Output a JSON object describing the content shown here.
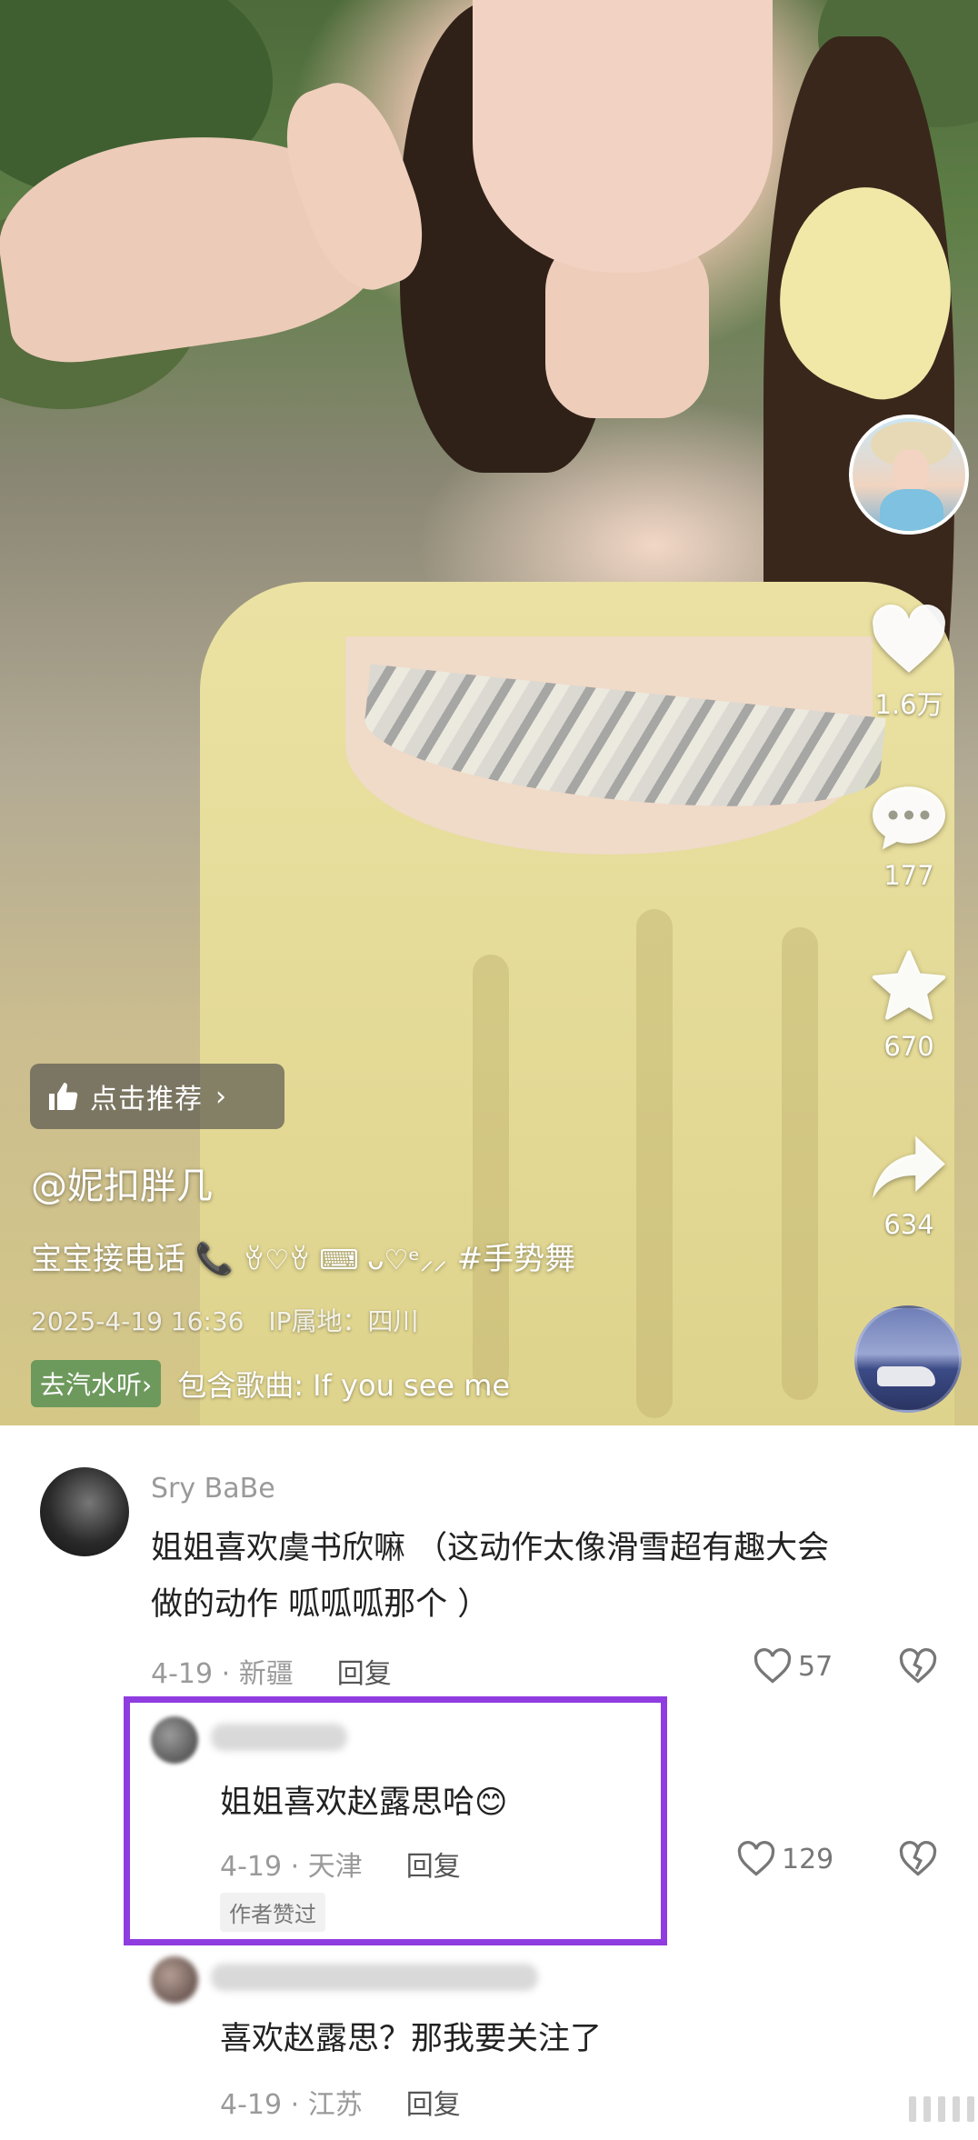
{
  "video": {
    "creator_avatar_icon": "creator-avatar",
    "likes": "1.6万",
    "comments": "177",
    "favorites": "670",
    "shares": "634",
    "recommend_label": "点击推荐",
    "author": "@妮扣胖几",
    "caption_text": "宝宝接电话",
    "caption_deco": "ꈊ♡ꈊ ⌨ ᴗ♡ᵉ⸝⸝",
    "caption_tag": "#手势舞",
    "date": "2025-4-19 16:36",
    "ip_location": "IP属地：四川",
    "music_tag": "去汽水听",
    "music_text": "包含歌曲: If you see me"
  },
  "comments": [
    {
      "name": "Sry BaBe",
      "text_line1": "姐姐喜欢虞书欣嘛 （这动作太像滑雪超有趣大会",
      "text_line2": "做的动作 呱呱呱那个 ）",
      "meta": "4-19 · 新疆",
      "reply": "回复",
      "likes": "57"
    },
    {
      "text": "姐姐喜欢赵露思哈😊",
      "meta": "4-19 · 天津",
      "reply": "回复",
      "likes": "129",
      "badge": "作者赞过"
    },
    {
      "text": "喜欢赵露思？那我要关注了",
      "meta": "4-19 · 江苏",
      "reply": "回复"
    }
  ],
  "colors": {
    "highlight_border": "#8f3ce0",
    "music_tag_bg": "#508c50"
  }
}
